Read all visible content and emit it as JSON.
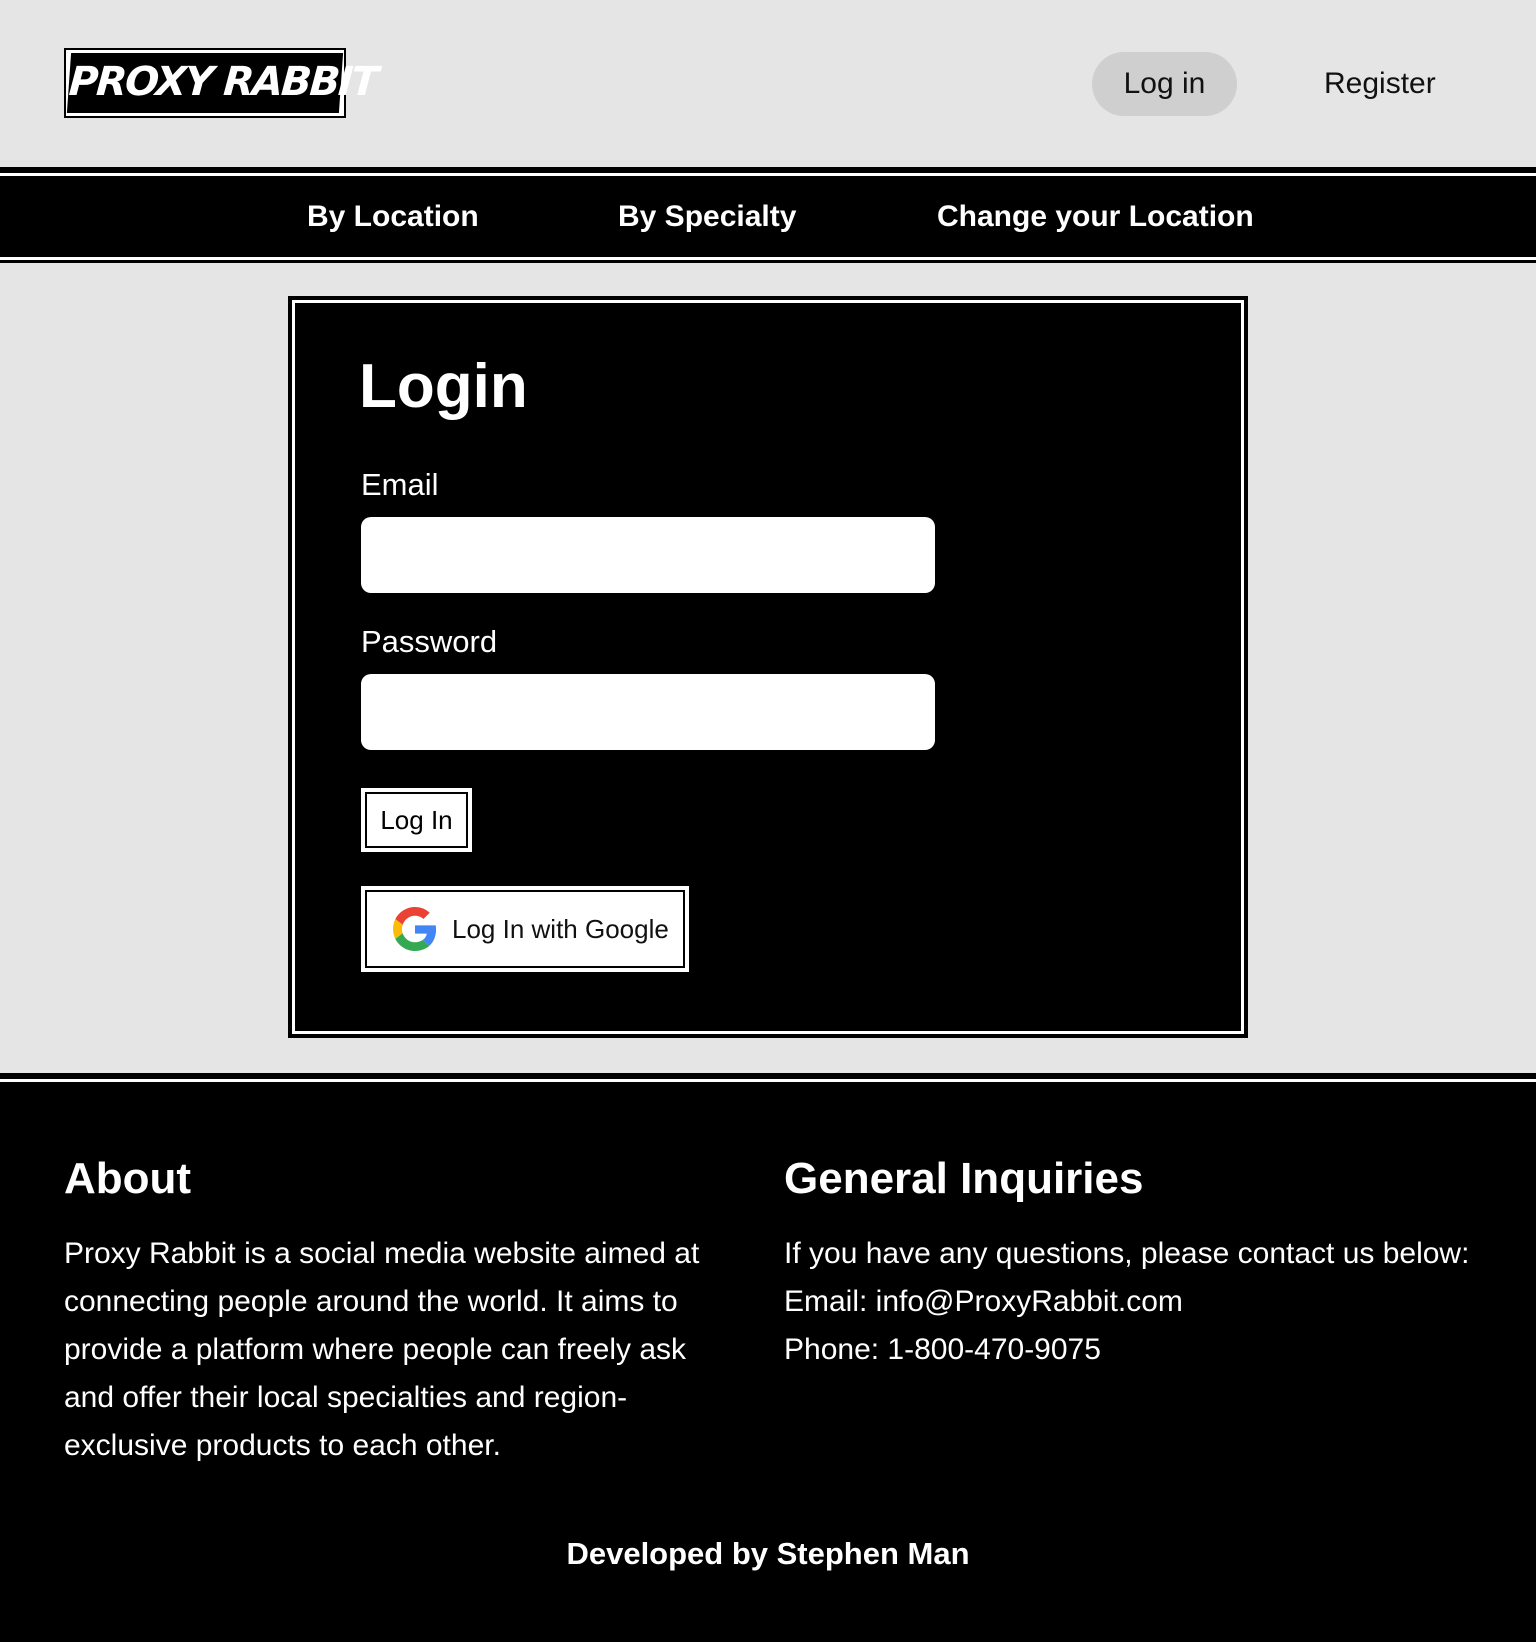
{
  "brand": {
    "logo_text": "PROXY RABBIT"
  },
  "header": {
    "login_label": "Log in",
    "register_label": "Register"
  },
  "nav": {
    "by_location": "By Location",
    "by_specialty": "By Specialty",
    "change_location": "Change your Location"
  },
  "login": {
    "title": "Login",
    "email_label": "Email",
    "email_value": "",
    "password_label": "Password",
    "password_value": "",
    "submit_label": "Log In",
    "google_label": "Log In with Google",
    "google_icon": "google-g-icon"
  },
  "footer": {
    "about_heading": "About",
    "about_text": "Proxy Rabbit is a social media website aimed at connecting people around the world. It aims to provide a platform where people can freely ask and offer their local specialties and region-exclusive products to each other.",
    "inquiries_heading": "General Inquiries",
    "inquiries_intro": "If you have any questions, please contact us below:",
    "inquiries_email": "Email: info@ProxyRabbit.com",
    "inquiries_phone": "Phone: 1-800-470-9075",
    "credit": "Developed by Stephen Man"
  },
  "colors": {
    "page_background": "#e6e5e6",
    "band_background": "#000000",
    "login_pill": "#cfcfcf",
    "text_light": "#ffffff"
  }
}
